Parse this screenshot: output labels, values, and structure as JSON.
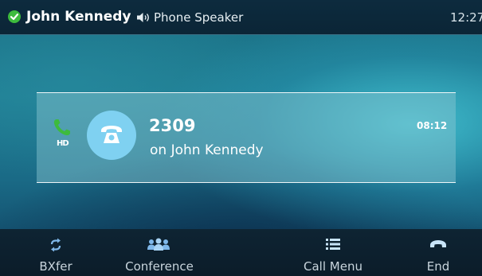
{
  "status_bar": {
    "user_name": "John Kennedy",
    "audio_mode": "Phone Speaker",
    "time": "12:27",
    "icons": [
      "status-check-icon",
      "speaker-icon"
    ],
    "status_color": "#3dbb3d"
  },
  "call": {
    "number": "2309",
    "line": "on John Kennedy",
    "duration": "08:12",
    "hd_badge": "HD",
    "icons": [
      "active-call-handset-icon",
      "contact-phone-icon"
    ],
    "accent_color": "#7fd1f1",
    "handset_color": "#3dbb3d"
  },
  "softkeys": [
    {
      "label": "BXfer",
      "icon": "transfer-arrows-icon"
    },
    {
      "label": "Conference",
      "icon": "conference-people-icon"
    },
    {
      "label": "Call Menu",
      "icon": "menu-list-icon"
    },
    {
      "label": "End",
      "icon": "end-call-icon"
    }
  ]
}
